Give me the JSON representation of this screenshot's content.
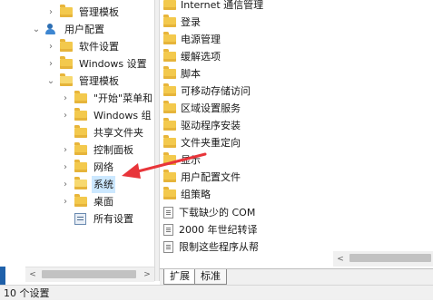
{
  "tree": {
    "items": [
      {
        "label": "管理模板",
        "expander": "›"
      },
      {
        "label": "用户配置",
        "expander": "⌄"
      },
      {
        "label": "软件设置",
        "expander": "›"
      },
      {
        "label": "Windows 设置",
        "expander": "›"
      },
      {
        "label": "管理模板",
        "expander": "⌄"
      },
      {
        "label": "\"开始\"菜单和",
        "expander": "›"
      },
      {
        "label": "Windows 组",
        "expander": "›"
      },
      {
        "label": "共享文件夹",
        "expander": ""
      },
      {
        "label": "控制面板",
        "expander": "›"
      },
      {
        "label": "网络",
        "expander": "›"
      },
      {
        "label": "系统",
        "expander": "›"
      },
      {
        "label": "桌面",
        "expander": "›"
      },
      {
        "label": "所有设置",
        "expander": ""
      }
    ]
  },
  "list": {
    "items": [
      {
        "label": "Internet 通信管理",
        "icon": "folder"
      },
      {
        "label": "登录",
        "icon": "folder"
      },
      {
        "label": "电源管理",
        "icon": "folder"
      },
      {
        "label": "缓解选项",
        "icon": "folder"
      },
      {
        "label": "脚本",
        "icon": "folder"
      },
      {
        "label": "可移动存储访问",
        "icon": "folder"
      },
      {
        "label": "区域设置服务",
        "icon": "folder"
      },
      {
        "label": "驱动程序安装",
        "icon": "folder"
      },
      {
        "label": "文件夹重定向",
        "icon": "folder"
      },
      {
        "label": "显示",
        "icon": "folder"
      },
      {
        "label": "用户配置文件",
        "icon": "folder"
      },
      {
        "label": "组策略",
        "icon": "folder"
      },
      {
        "label": "下载缺少的 COM",
        "icon": "document"
      },
      {
        "label": "2000 年世纪转译",
        "icon": "document"
      },
      {
        "label": "限制这些程序从帮",
        "icon": "document"
      }
    ]
  },
  "tabs": [
    {
      "label": "扩展"
    },
    {
      "label": "标准"
    }
  ],
  "status": {
    "text": "10 个设置"
  },
  "scroll": {
    "left_arrow": "<",
    "right_arrow": ">"
  },
  "colors": {
    "selection": "#cce8ff",
    "folder": "#f3c94d",
    "annotation_arrow": "#e8353a"
  }
}
